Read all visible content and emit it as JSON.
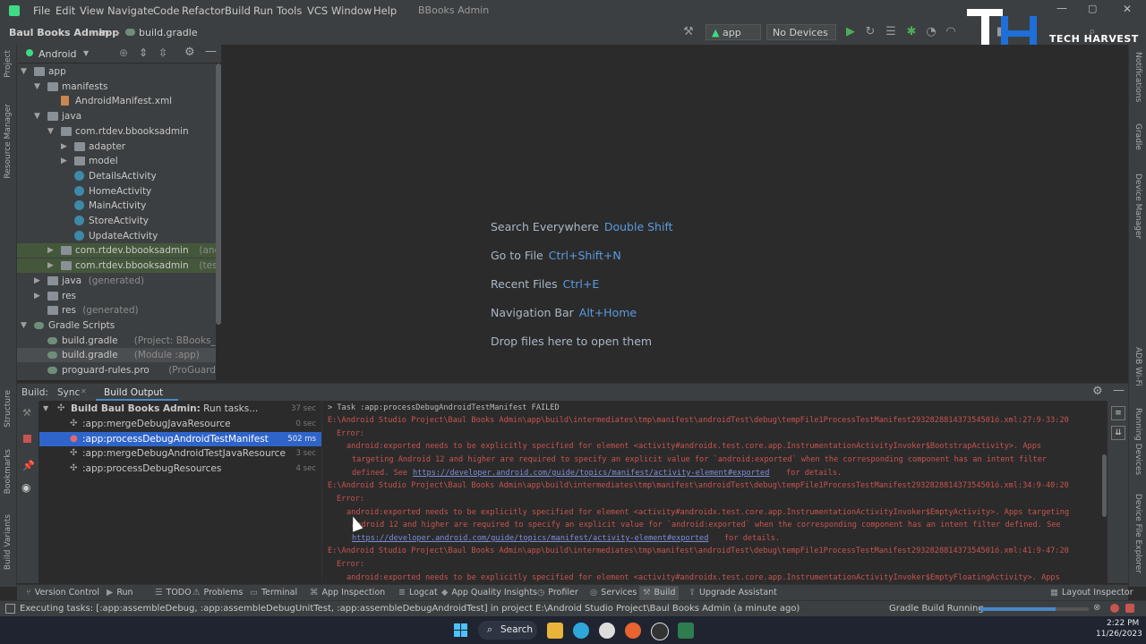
{
  "menu": [
    "File",
    "Edit",
    "View",
    "Navigate",
    "Code",
    "Refactor",
    "Build",
    "Run",
    "Tools",
    "VCS",
    "Window",
    "Help"
  ],
  "window_title": "BBooks Admin",
  "breadcrumb": {
    "project": "Baul Books Admin",
    "module": "app",
    "file": "build.gradle"
  },
  "toolbar": {
    "run_config": "app",
    "device": "No Devices"
  },
  "logo_text": "TECH HARVEST",
  "project_panel": {
    "view_mode": "Android",
    "tree": [
      {
        "label": "app",
        "muted": ""
      },
      {
        "label": "manifests",
        "muted": ""
      },
      {
        "label": "AndroidManifest.xml",
        "muted": ""
      },
      {
        "label": "java",
        "muted": ""
      },
      {
        "label": "com.rtdev.bbooksadmin",
        "muted": ""
      },
      {
        "label": "adapter",
        "muted": ""
      },
      {
        "label": "model",
        "muted": ""
      },
      {
        "label": "DetailsActivity",
        "muted": ""
      },
      {
        "label": "HomeActivity",
        "muted": ""
      },
      {
        "label": "MainActivity",
        "muted": ""
      },
      {
        "label": "StoreActivity",
        "muted": ""
      },
      {
        "label": "UpdateActivity",
        "muted": ""
      },
      {
        "label": "com.rtdev.bbooksadmin",
        "muted": "(androidTes"
      },
      {
        "label": "com.rtdev.bbooksadmin",
        "muted": "(test)"
      },
      {
        "label": "java",
        "muted": "(generated)"
      },
      {
        "label": "res",
        "muted": ""
      },
      {
        "label": "res",
        "muted": "(generated)"
      },
      {
        "label": "Gradle Scripts",
        "muted": ""
      },
      {
        "label": "build.gradle",
        "muted": "(Project: BBooks_Admin)"
      },
      {
        "label": "build.gradle",
        "muted": "(Module :app)"
      },
      {
        "label": "proguard-rules.pro",
        "muted": "(ProGuard Rules for \""
      }
    ]
  },
  "left_strip": {
    "project": "Project",
    "resource_manager": "Resource Manager",
    "structure": "Structure",
    "bookmarks": "Bookmarks",
    "build_variants": "Build Variants"
  },
  "right_strip": {
    "notifications": "Notifications",
    "gradle": "Gradle",
    "device_manager": "Device Manager",
    "adb_wifi": "ADB Wi-Fi",
    "running_devices": "Running Devices",
    "device_file_explorer": "Device File Explorer"
  },
  "editor_hints": [
    {
      "label": "Search Everywhere",
      "key": "Double Shift"
    },
    {
      "label": "Go to File",
      "key": "Ctrl+Shift+N"
    },
    {
      "label": "Recent Files",
      "key": "Ctrl+E"
    },
    {
      "label": "Navigation Bar",
      "key": "Alt+Home"
    },
    {
      "label": "Drop files here to open them",
      "key": ""
    }
  ],
  "build_panel": {
    "title": "Build:",
    "tab_sync": "Sync",
    "tab_output": "Build Output",
    "tree": [
      {
        "label": "Build Baul Books Admin:",
        "suffix": " Run tasks...",
        "time": "37 sec"
      },
      {
        "label": ":app:mergeDebugJavaResource",
        "suffix": "",
        "time": "0 sec"
      },
      {
        "label": ":app:processDebugAndroidTestManifest",
        "suffix": "",
        "time": "502 ms"
      },
      {
        "label": ":app:mergeDebugAndroidTestJavaResource",
        "suffix": "",
        "time": "3 sec"
      },
      {
        "label": ":app:processDebugResources",
        "suffix": "",
        "time": "4 sec"
      }
    ],
    "output": [
      "> Task :app:processDebugAndroidTestManifest FAILED",
      "E:\\Android Studio Project\\Baul Books Admin\\app\\build\\intermediates\\tmp\\manifest\\androidTest\\debug\\tempFile1ProcessTestManifest293282881437354501ó.xml:27:9-33:20",
      "Error:",
      "android:exported needs to be explicitly specified for element <activity#androidx.test.core.app.InstrumentationActivityInvoker$BootstrapActivity>. Apps",
      "targeting Android 12 and higher are required to specify an explicit value for `android:exported` when the corresponding component has an intent filter",
      "defined. See",
      "https://developer.android.com/guide/topics/manifest/activity-element#exported",
      "for details.",
      "E:\\Android Studio Project\\Baul Books Admin\\app\\build\\intermediates\\tmp\\manifest\\androidTest\\debug\\tempFile1ProcessTestManifest293282881437354501ó.xml:34:9-40:20",
      "Error:",
      "android:exported needs to be explicitly specified for element <activity#androidx.test.core.app.InstrumentationActivityInvoker$EmptyActivity>. Apps targeting",
      "Android 12 and higher are required to specify an explicit value for `android:exported` when the corresponding component has an intent filter defined. See",
      "https://developer.android.com/guide/topics/manifest/activity-element#exported",
      "for details.",
      "E:\\Android Studio Project\\Baul Books Admin\\app\\build\\intermediates\\tmp\\manifest\\androidTest\\debug\\tempFile1ProcessTestManifest293282881437354501ó.xml:41:9-47:20",
      "Error:",
      "android:exported needs to be explicitly specified for element <activity#androidx.test.core.app.InstrumentationActivityInvoker$EmptyFloatingActivity>. Apps"
    ]
  },
  "tool_windows": [
    "Version Control",
    "Run",
    "TODO",
    "Problems",
    "Terminal",
    "App Inspection",
    "Logcat",
    "App Quality Insights",
    "Profiler",
    "Services",
    "Build",
    "Upgrade Assistant",
    "Layout Inspector"
  ],
  "status_bar": {
    "message": "Executing tasks: [:app:assembleDebug, :app:assembleDebugUnitTest, :app:assembleDebugAndroidTest] in project E:\\Android Studio Project\\Baul Books Admin (a minute ago)",
    "progress_label": "Gradle Build Running",
    "progress_fraction": 0.7
  },
  "taskbar": {
    "search": "Search",
    "time": "2:22 PM",
    "date": "11/26/2023"
  }
}
